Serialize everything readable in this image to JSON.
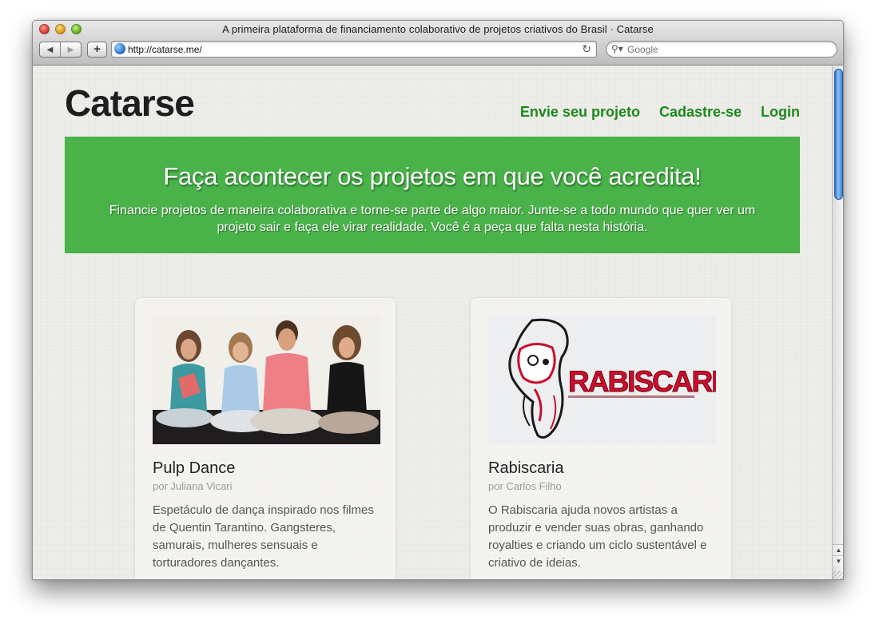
{
  "window": {
    "title": "A primeira plataforma de financiamento colaborativo de projetos criativos do Brasil · Catarse"
  },
  "toolbar": {
    "back_icon": "back-arrow-icon",
    "forward_icon": "forward-arrow-icon",
    "add_label": "+",
    "url": "http://catarse.me/",
    "search_placeholder": "Google"
  },
  "site": {
    "logo": "Catarse",
    "nav": [
      {
        "label": "Envie seu projeto"
      },
      {
        "label": "Cadastre-se"
      },
      {
        "label": "Login"
      }
    ]
  },
  "hero": {
    "title": "Faça acontecer os projetos em que você acredita!",
    "subtitle": "Financie projetos de maneira colaborativa e torne-se parte de algo maior. Junte-se a todo mundo que quer ver um projeto sair e faça ele virar realidade. Você é a peça que falta nesta história."
  },
  "projects": [
    {
      "title": "Pulp Dance",
      "author": "por Juliana Vicari",
      "description": "Espetáculo de dança inspirado nos filmes de Quentin Tarantino. Gangsteres, samurais, mulheres sensuais e torturadores dançantes."
    },
    {
      "title": "Rabiscaria",
      "author": "por Carlos Filho",
      "description": "O Rabiscaria ajuda novos artistas a produzir e vender suas obras, ganhando royalties e criando um ciclo sustentável e criativo de ideias.",
      "logo_text": "RABISCARIA"
    }
  ],
  "colors": {
    "brand_green": "#49b349",
    "nav_green": "#1b8a1b"
  }
}
